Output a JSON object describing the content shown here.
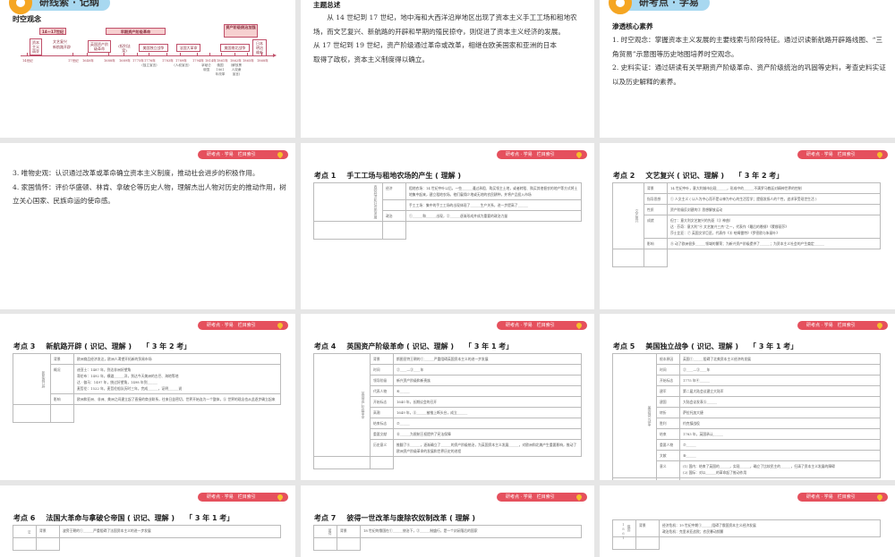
{
  "slide1": {
    "tag": "研线索 · 记纲",
    "title": "时空观念",
    "periods": [
      "14—17世纪",
      "早期资产阶级革命",
      "资产阶级统治加强"
    ],
    "events": [
      "资本主义萌芽",
      "文艺复兴",
      "新航路开辟",
      "英国资产阶级革命",
      "(权利法案)",
      "美国独立战争",
      "法国大革命",
      "美国南北战争",
      "日本明治维新"
    ],
    "ticks": [
      "14世纪",
      "17世纪",
      "1640年",
      "1688年",
      "1689年",
      "1775年",
      "1776年",
      "1783年",
      "1789年",
      "1794年",
      "1814年",
      "1861年",
      "1862年",
      "1865年",
      "1868年"
    ],
    "notes": [
      "(独立宣言)",
      "(人权宣言)",
      "拿破仑帝国",
      "俄国1861年改革",
      "(解放黑人奴隶宣言)"
    ]
  },
  "slide2": {
    "title": "主题总述",
    "paragraphs": [
      "从 14 世纪到 17 世纪，地中海和大西洋沿岸地区出现了资本主义手工工场和租地农场，而文艺复兴、新航路的开辟和早期的殖民掠夺，则促进了资本主义经济的发展。",
      "从 17 世纪到 19 世纪，资产阶级通过革命或改革，相继在欧美国家和亚洲的日本",
      "取得了政权，资本主义制度得以确立。"
    ]
  },
  "slide3": {
    "tag": "研考点 · 学易",
    "title": "渗透核心素养",
    "items": [
      "1. 时空观念：掌握资本主义发展的主要线索与阶段特征。通过识读新航路开辟路线图、“三角贸易”示意图等历史地图培养时空观念。",
      "2. 史料实证：通过研读有关早期资产阶级革命、资产阶级统治的巩固等史料，考查史料实证以及历史解释的素养。"
    ]
  },
  "badge": "研考点 · 学易　栏目索引",
  "slide4": {
    "items": [
      "3. 唯物史观：认识通过改革或革命确立资本主义制度，推动社会进步的积极作用。",
      "4. 家国情怀：评价华盛顿、林肯、拿破仑等历史人物，理解杰出人物对历史的推动作用，树立关心国家、民族命运的使命感。"
    ]
  },
  "kaodian": [
    {
      "num": "考点 1",
      "title": "手工工场与租地农场的产生 ( 理解 )",
      "freq": "",
      "side": "西欧经济和社会的发展",
      "rows": [
        [
          "经济",
          "租地农场：14 世纪中叶以后，一些______通过承租、购买领主土地，或者转租、购买其他佃农的地产等方式将土地集中起来，建立租地农场。他们雇佣少地或无地的农民耕种，并将产品投入市场"
        ],
        [
          "",
          "手工工场：集中的手工工场的出现体现了______生产关系，进一步提高了______"
        ],
        [
          "政治",
          "①______和______出现，②______逐渐形成并成为重要的政治力量"
        ]
      ]
    },
    {
      "num": "考点 2",
      "title": "文艺复兴 ( 识记、理解 )",
      "freq": "「 3 年 2 考」",
      "side": "文艺复兴",
      "rows": [
        [
          "背景",
          "14 世纪中叶，意大利城市出现______，形成中的______不满罗马教廷对精神世界的控制"
        ],
        [
          "指导思想",
          "① 人文主义 ( 以人为中心而不是以神为中心的生活哲学；提倡发扬人的个性，追求享受现世生活 )"
        ],
        [
          "性质",
          "资产阶级反封建的② 思想解放运动"
        ],
        [
          "成就",
          "但丁：意大利文艺复兴的先驱（③ 神曲）\n达 · 芬奇：意大利“④ 文艺复兴三杰”之一，代表作《最后的晚餐》《蒙娜丽莎》\n莎士比亚：⑦ 英国文学巨匠，代表作《⑧ 哈姆雷特》《罗密欧与朱丽叶》"
        ],
        [
          "影响",
          "⑨ 动了欧洲很多______领域的繁荣；为新兴资产阶级提供了______；为资本主义社会的产生奠定______"
        ]
      ]
    },
    {
      "num": "考点 3",
      "title": "新航路开辟 ( 识记、理解 )",
      "freq": "「 3 年 2 考」",
      "side": "新航路开辟",
      "rows": [
        [
          "背景",
          "欧洲商品经济发达，欧洲人渴望开拓新的贸易市场"
        ],
        [
          "概况",
          "迪亚士：1487 年，到达非洲好望角\n哥伦布：1492 年，横渡______洋，到达今天美洲的古巴、海地等地\n达 · 伽马：1497 年，绕过好望角，1498 年到______\n麦哲伦：1522 年，麦哲伦船队历时三年，完成______，证明______说"
        ],
        [
          "影响",
          "欧洲和亚洲、非洲、美洲之间建立起了直接的商业联系，往来日益密切，世界开始连为一个整体，⑤ 世界的观念也从此逐步确立起来"
        ]
      ]
    },
    {
      "num": "考点 4",
      "title": "英国资产阶级革命 ( 识记、理解 )",
      "freq": "「 3 年 1 考」",
      "side": "英国资产阶级革命",
      "rows": [
        [
          "背景",
          "斯图亚特王朝的①______严重阻碍英国资本主义的进一步发展"
        ],
        [
          "时间",
          "②____—③____年"
        ],
        [
          "领导阶级",
          "新兴资产阶级和新贵族"
        ],
        [
          "代表人物",
          "④______"
        ],
        [
          "开始标志",
          "1640 年，长期议会的召开"
        ],
        [
          "高潮",
          "1649 年，⑤______被推上断头台，成立______"
        ],
        [
          "结束标志",
          "⑦______"
        ],
        [
          "重要文献",
          "⑧______为限制王权提供了宪法保障"
        ],
        [
          "历史意义",
          "推翻了⑨______，逐渐确立了______的资产阶级统治，为英国资本主义发展______，对欧洲和北美产生重要影响，推动了欧洲资产阶级革命的发展和世界历史的进程"
        ]
      ]
    },
    {
      "num": "考点 5",
      "title": "美国独立战争 ( 识记、理解 )",
      "freq": "「 3 年 1 考」",
      "side": "美国独立战争",
      "rows": [
        [
          "根本原因",
          "英国①______阻碍了北美资本主义经济的发展"
        ],
        [
          "时间",
          "②____—③____年"
        ],
        [
          "开始标志",
          "1775 年④______"
        ],
        [
          "建军",
          "第二届大陆会议建立大陆军"
        ],
        [
          "建国",
          "大陆会议发表⑤______"
        ],
        [
          "转折",
          "萨拉托加大捷"
        ],
        [
          "胜利",
          "约克镇战役"
        ],
        [
          "结束",
          "1783 年，英国承认______"
        ],
        [
          "重要人物",
          "⑦______"
        ],
        [
          "文献",
          "⑧______"
        ],
        [
          "意义",
          "(1) 国内：结束了英国的______，实现______，确立了比较民主的______，扫清了资本主义发展的障碍\n(2) 国际：对以______的革命起了推动作用"
        ]
      ]
    },
    {
      "num": "考点 6",
      "title": "法国大革命与拿破仑帝国 ( 识记、理解 )",
      "freq": "「 3 年 1 考」",
      "side": "法",
      "rows": [
        [
          "背景",
          "波旁王朝的①______严重阻碍了法国资本主义的进一步发展"
        ]
      ]
    },
    {
      "num": "考点 7",
      "title": "彼得一世改革与废除农奴制改革 ( 理解 )",
      "freq": "",
      "side": "彼得",
      "rows": [
        [
          "背景",
          "18 世纪的俄国在①______统治下，②______制盛行，是一个封闭落后的国家"
        ]
      ]
    },
    {
      "num": "",
      "title": "",
      "freq": "",
      "side": "俄国1861",
      "rows": [
        [
          "背景",
          "经济危机：19 世纪中期①______阻碍了俄国资本主义经济发展\n政治危机：克里米亚战败；农民暴动频繁"
        ]
      ]
    }
  ]
}
